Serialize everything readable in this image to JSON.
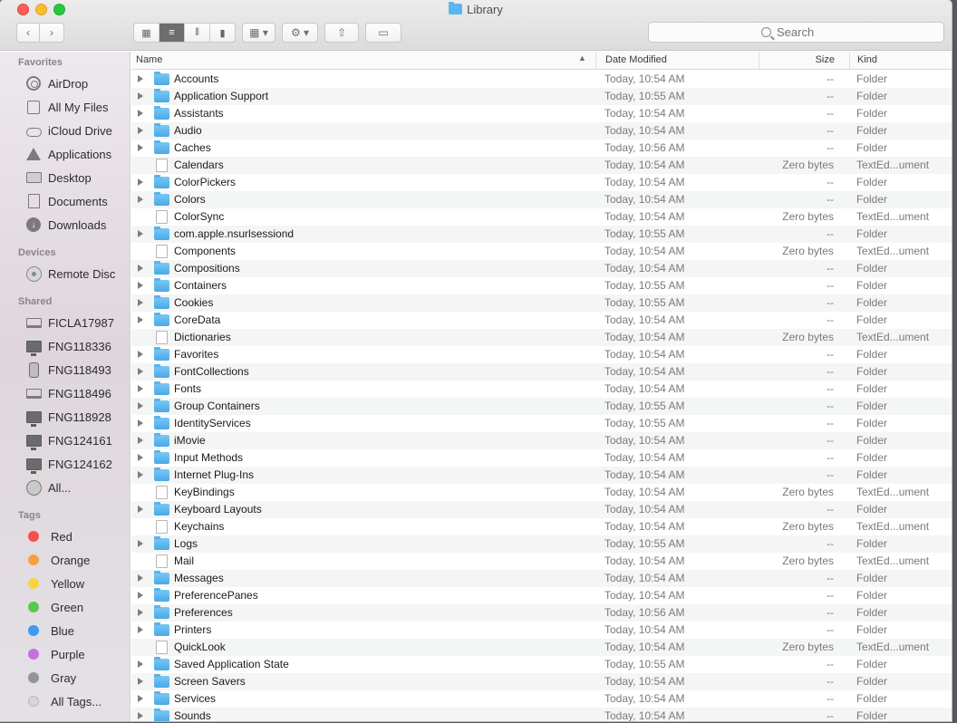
{
  "window": {
    "title": "Library"
  },
  "toolbar": {
    "back_icon": "chevron-left",
    "forward_icon": "chevron-right",
    "view_modes": [
      "icon-view",
      "list-view",
      "column-view",
      "coverflow-view"
    ],
    "active_view": "list-view",
    "search_placeholder": "Search"
  },
  "sidebar": {
    "favorites_header": "Favorites",
    "favorites": [
      {
        "label": "AirDrop",
        "icon": "airdrop-icon"
      },
      {
        "label": "All My Files",
        "icon": "all-my-files-icon"
      },
      {
        "label": "iCloud Drive",
        "icon": "cloud-icon"
      },
      {
        "label": "Applications",
        "icon": "applications-icon"
      },
      {
        "label": "Desktop",
        "icon": "desktop-icon"
      },
      {
        "label": "Documents",
        "icon": "document-icon"
      },
      {
        "label": "Downloads",
        "icon": "download-icon"
      }
    ],
    "devices_header": "Devices",
    "devices": [
      {
        "label": "Remote Disc",
        "icon": "disc-icon"
      }
    ],
    "shared_header": "Shared",
    "shared": [
      {
        "label": "FICLA17987",
        "icon": "laptop-icon"
      },
      {
        "label": "FNG118336",
        "icon": "monitor-icon"
      },
      {
        "label": "FNG118493",
        "icon": "tower-icon"
      },
      {
        "label": "FNG118496",
        "icon": "laptop-icon"
      },
      {
        "label": "FNG118928",
        "icon": "monitor-icon"
      },
      {
        "label": "FNG124161",
        "icon": "monitor-icon"
      },
      {
        "label": "FNG124162",
        "icon": "monitor-icon"
      },
      {
        "label": "All...",
        "icon": "globe-icon"
      }
    ],
    "tags_header": "Tags",
    "tags": [
      {
        "label": "Red",
        "color": "#f5504a"
      },
      {
        "label": "Orange",
        "color": "#f6a23c"
      },
      {
        "label": "Yellow",
        "color": "#f7d43e"
      },
      {
        "label": "Green",
        "color": "#5ac84d"
      },
      {
        "label": "Blue",
        "color": "#3d9bf0"
      },
      {
        "label": "Purple",
        "color": "#c571dc"
      },
      {
        "label": "Gray",
        "color": "#959595"
      },
      {
        "label": "All Tags...",
        "color": "#d6d6d6"
      }
    ]
  },
  "columns": {
    "name": "Name",
    "date": "Date Modified",
    "size": "Size",
    "kind": "Kind"
  },
  "files": [
    {
      "name": "Accounts",
      "date": "Today, 10:54 AM",
      "size": "--",
      "kind": "Folder",
      "type": "folder"
    },
    {
      "name": "Application Support",
      "date": "Today, 10:55 AM",
      "size": "--",
      "kind": "Folder",
      "type": "folder"
    },
    {
      "name": "Assistants",
      "date": "Today, 10:54 AM",
      "size": "--",
      "kind": "Folder",
      "type": "folder"
    },
    {
      "name": "Audio",
      "date": "Today, 10:54 AM",
      "size": "--",
      "kind": "Folder",
      "type": "folder"
    },
    {
      "name": "Caches",
      "date": "Today, 10:56 AM",
      "size": "--",
      "kind": "Folder",
      "type": "folder"
    },
    {
      "name": "Calendars",
      "date": "Today, 10:54 AM",
      "size": "Zero bytes",
      "kind": "TextEd...ument",
      "type": "file"
    },
    {
      "name": "ColorPickers",
      "date": "Today, 10:54 AM",
      "size": "--",
      "kind": "Folder",
      "type": "folder"
    },
    {
      "name": "Colors",
      "date": "Today, 10:54 AM",
      "size": "--",
      "kind": "Folder",
      "type": "folder"
    },
    {
      "name": "ColorSync",
      "date": "Today, 10:54 AM",
      "size": "Zero bytes",
      "kind": "TextEd...ument",
      "type": "file"
    },
    {
      "name": "com.apple.nsurlsessiond",
      "date": "Today, 10:55 AM",
      "size": "--",
      "kind": "Folder",
      "type": "folder"
    },
    {
      "name": "Components",
      "date": "Today, 10:54 AM",
      "size": "Zero bytes",
      "kind": "TextEd...ument",
      "type": "file"
    },
    {
      "name": "Compositions",
      "date": "Today, 10:54 AM",
      "size": "--",
      "kind": "Folder",
      "type": "folder"
    },
    {
      "name": "Containers",
      "date": "Today, 10:55 AM",
      "size": "--",
      "kind": "Folder",
      "type": "folder"
    },
    {
      "name": "Cookies",
      "date": "Today, 10:55 AM",
      "size": "--",
      "kind": "Folder",
      "type": "folder"
    },
    {
      "name": "CoreData",
      "date": "Today, 10:54 AM",
      "size": "--",
      "kind": "Folder",
      "type": "folder"
    },
    {
      "name": "Dictionaries",
      "date": "Today, 10:54 AM",
      "size": "Zero bytes",
      "kind": "TextEd...ument",
      "type": "file"
    },
    {
      "name": "Favorites",
      "date": "Today, 10:54 AM",
      "size": "--",
      "kind": "Folder",
      "type": "folder"
    },
    {
      "name": "FontCollections",
      "date": "Today, 10:54 AM",
      "size": "--",
      "kind": "Folder",
      "type": "folder"
    },
    {
      "name": "Fonts",
      "date": "Today, 10:54 AM",
      "size": "--",
      "kind": "Folder",
      "type": "folder"
    },
    {
      "name": "Group Containers",
      "date": "Today, 10:55 AM",
      "size": "--",
      "kind": "Folder",
      "type": "folder"
    },
    {
      "name": "IdentityServices",
      "date": "Today, 10:55 AM",
      "size": "--",
      "kind": "Folder",
      "type": "folder"
    },
    {
      "name": "iMovie",
      "date": "Today, 10:54 AM",
      "size": "--",
      "kind": "Folder",
      "type": "folder"
    },
    {
      "name": "Input Methods",
      "date": "Today, 10:54 AM",
      "size": "--",
      "kind": "Folder",
      "type": "folder"
    },
    {
      "name": "Internet Plug-Ins",
      "date": "Today, 10:54 AM",
      "size": "--",
      "kind": "Folder",
      "type": "folder"
    },
    {
      "name": "KeyBindings",
      "date": "Today, 10:54 AM",
      "size": "Zero bytes",
      "kind": "TextEd...ument",
      "type": "file"
    },
    {
      "name": "Keyboard Layouts",
      "date": "Today, 10:54 AM",
      "size": "--",
      "kind": "Folder",
      "type": "folder"
    },
    {
      "name": "Keychains",
      "date": "Today, 10:54 AM",
      "size": "Zero bytes",
      "kind": "TextEd...ument",
      "type": "file"
    },
    {
      "name": "Logs",
      "date": "Today, 10:55 AM",
      "size": "--",
      "kind": "Folder",
      "type": "folder"
    },
    {
      "name": "Mail",
      "date": "Today, 10:54 AM",
      "size": "Zero bytes",
      "kind": "TextEd...ument",
      "type": "file"
    },
    {
      "name": "Messages",
      "date": "Today, 10:54 AM",
      "size": "--",
      "kind": "Folder",
      "type": "folder"
    },
    {
      "name": "PreferencePanes",
      "date": "Today, 10:54 AM",
      "size": "--",
      "kind": "Folder",
      "type": "folder"
    },
    {
      "name": "Preferences",
      "date": "Today, 10:56 AM",
      "size": "--",
      "kind": "Folder",
      "type": "folder"
    },
    {
      "name": "Printers",
      "date": "Today, 10:54 AM",
      "size": "--",
      "kind": "Folder",
      "type": "folder"
    },
    {
      "name": "QuickLook",
      "date": "Today, 10:54 AM",
      "size": "Zero bytes",
      "kind": "TextEd...ument",
      "type": "file"
    },
    {
      "name": "Saved Application State",
      "date": "Today, 10:55 AM",
      "size": "--",
      "kind": "Folder",
      "type": "folder"
    },
    {
      "name": "Screen Savers",
      "date": "Today, 10:54 AM",
      "size": "--",
      "kind": "Folder",
      "type": "folder"
    },
    {
      "name": "Services",
      "date": "Today, 10:54 AM",
      "size": "--",
      "kind": "Folder",
      "type": "folder"
    },
    {
      "name": "Sounds",
      "date": "Today, 10:54 AM",
      "size": "--",
      "kind": "Folder",
      "type": "folder"
    }
  ]
}
